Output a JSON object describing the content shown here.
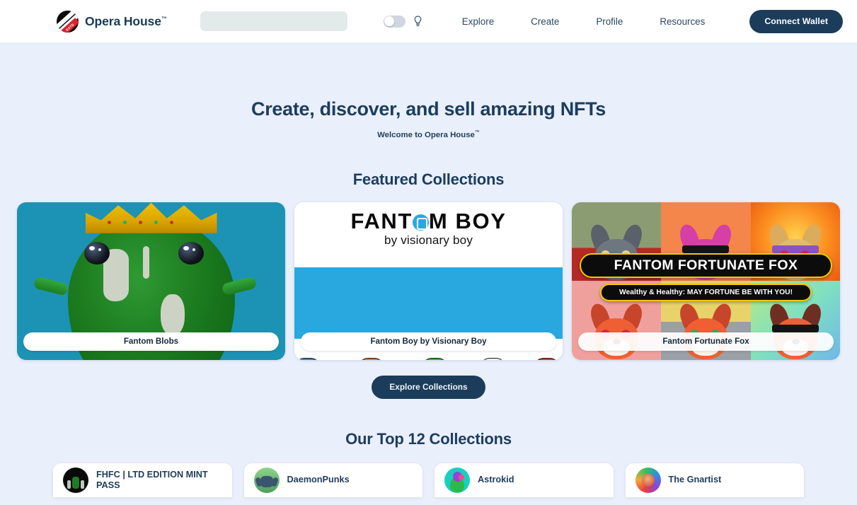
{
  "header": {
    "brand_name": "Opera House",
    "brand_tm": "™",
    "logo_ribbon_text": "ESTD",
    "search_value": "",
    "search_placeholder": "",
    "theme_toggle_state": "off",
    "bulb_icon": "lightbulb-icon",
    "nav": [
      {
        "label": "Explore"
      },
      {
        "label": "Create"
      },
      {
        "label": "Profile"
      },
      {
        "label": "Resources"
      }
    ],
    "connect_wallet_label": "Connect Wallet"
  },
  "hero": {
    "title": "Create, discover, and sell amazing NFTs",
    "subtitle": "Welcome to Opera House",
    "subtitle_tm": "™"
  },
  "featured": {
    "heading": "Featured Collections",
    "cards": [
      {
        "label": "Fantom Blobs"
      },
      {
        "label": "Fantom Boy by Visionary Boy",
        "art_title_left": "FANT",
        "art_title_right": "M BOY",
        "art_subtitle": "by visionary boy"
      },
      {
        "label": "Fantom Fortunate Fox",
        "art_banner": "FANTOM FORTUNATE FOX",
        "art_tagline": "Wealthy & Healthy: MAY FORTUNE BE WITH YOU!"
      }
    ],
    "explore_button_label": "Explore Collections"
  },
  "top12": {
    "heading": "Our Top 12 Collections",
    "cards": [
      {
        "label": "FHFC | LTD EDITION MINT PASS"
      },
      {
        "label": "DaemonPunks"
      },
      {
        "label": "Astrokid"
      },
      {
        "label": "The Gnartist"
      }
    ]
  },
  "colors": {
    "page_background": "#e9effb",
    "header_background": "#ffffff",
    "accent_navy": "#1b3c5a",
    "heading_text": "#1c3d5e",
    "search_field": "#e2eaea",
    "banner_gold": "#f2c900"
  }
}
